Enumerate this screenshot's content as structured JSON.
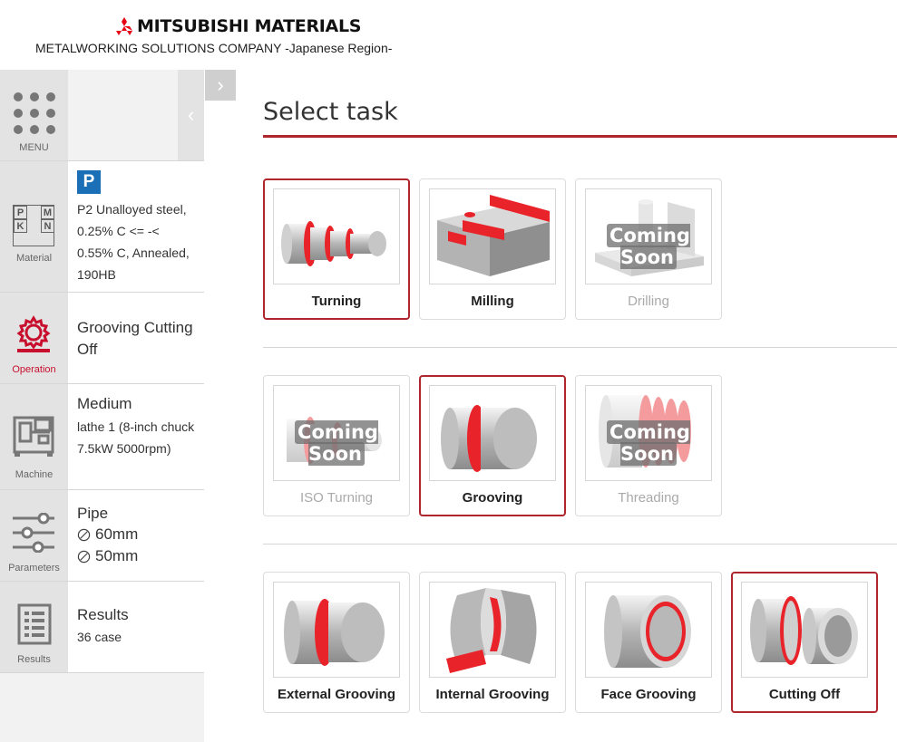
{
  "header": {
    "brand_name": "MITSUBISHI MATERIALS",
    "brand_sub": "METALWORKING SOLUTIONS COMPANY -Japanese Region-"
  },
  "colors": {
    "accent": "#b0262d",
    "badge_p": "#1a6fb7",
    "part_red": "#e8232a"
  },
  "sidebar": {
    "menu_label": "MENU",
    "material": {
      "caption": "Material",
      "grid": [
        "P",
        "M",
        "K",
        "N"
      ],
      "badge": "P",
      "text": "P2 Unalloyed steel, 0.25% C <= -< 0.55% C, Annealed, 190HB"
    },
    "operation": {
      "caption": "Operation",
      "text": "Grooving Cutting Off"
    },
    "machine": {
      "caption": "Machine",
      "title": "Medium",
      "text": "lathe 1 (8-inch chuck 7.5kW 5000rpm)"
    },
    "parameters": {
      "caption": "Parameters",
      "title": "Pipe",
      "outer": "60mm",
      "inner": "50mm"
    },
    "results": {
      "caption": "Results",
      "title": "Results",
      "count": "36 case"
    }
  },
  "main": {
    "title": "Select task",
    "coming_soon": "Coming Soon",
    "row1": [
      {
        "label": "Turning",
        "state": "selected"
      },
      {
        "label": "Milling",
        "state": "normal"
      },
      {
        "label": "Drilling",
        "state": "disabled"
      }
    ],
    "row2": [
      {
        "label": "ISO Turning",
        "state": "disabled"
      },
      {
        "label": "Grooving",
        "state": "selected"
      },
      {
        "label": "Threading",
        "state": "disabled"
      }
    ],
    "row3": [
      {
        "label": "External Grooving",
        "state": "normal"
      },
      {
        "label": "Internal Grooving",
        "state": "normal"
      },
      {
        "label": "Face Grooving",
        "state": "normal"
      },
      {
        "label": "Cutting Off",
        "state": "selected"
      }
    ]
  }
}
